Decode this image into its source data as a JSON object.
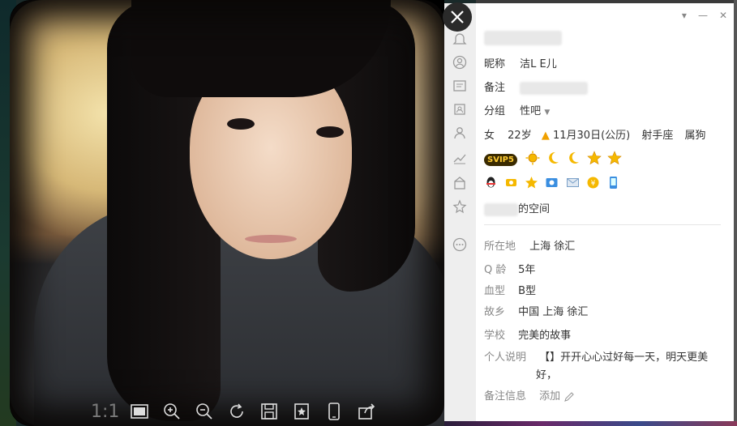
{
  "viewer": {
    "ratio_label": "1:1",
    "toolbar": [
      {
        "name": "fit-screen-icon"
      },
      {
        "name": "zoom-in-icon"
      },
      {
        "name": "zoom-out-icon"
      },
      {
        "name": "rotate-icon"
      },
      {
        "name": "save-icon"
      },
      {
        "name": "favorite-icon"
      },
      {
        "name": "phone-icon"
      },
      {
        "name": "share-icon"
      }
    ]
  },
  "profile": {
    "window_controls": [
      "▾",
      "—",
      "✕"
    ],
    "nickname_label": "昵称",
    "nickname_value": "洁L  E儿",
    "remark_label": "备注",
    "remark_value": "",
    "group_label": "分组",
    "group_value": "性吧",
    "gender": "女",
    "age": "22岁",
    "birthday": "11月30日(公历)",
    "zodiac": "射手座",
    "chinese_zodiac": "属狗",
    "vip_badge": "SVIP5",
    "space_suffix": "的空间",
    "location_label": "所在地",
    "location_value": "上海 徐汇",
    "qage_label": "Q 龄",
    "qage_value": "5年",
    "blood_label": "血型",
    "blood_value": "B型",
    "hometown_label": "故乡",
    "hometown_value": "中国 上海 徐汇",
    "school_label": "学校",
    "school_value": "完美的故事",
    "bio_label": "个人说明",
    "bio_line1": "【】开开心心过好每一天，明天更美",
    "bio_line2": "好，",
    "note_label": "备注信息",
    "note_action": "添加"
  },
  "colors": {
    "accent_gold": "#f0b400",
    "panel_bg": "#ffffff",
    "icon_col_bg": "#eeeeee"
  }
}
